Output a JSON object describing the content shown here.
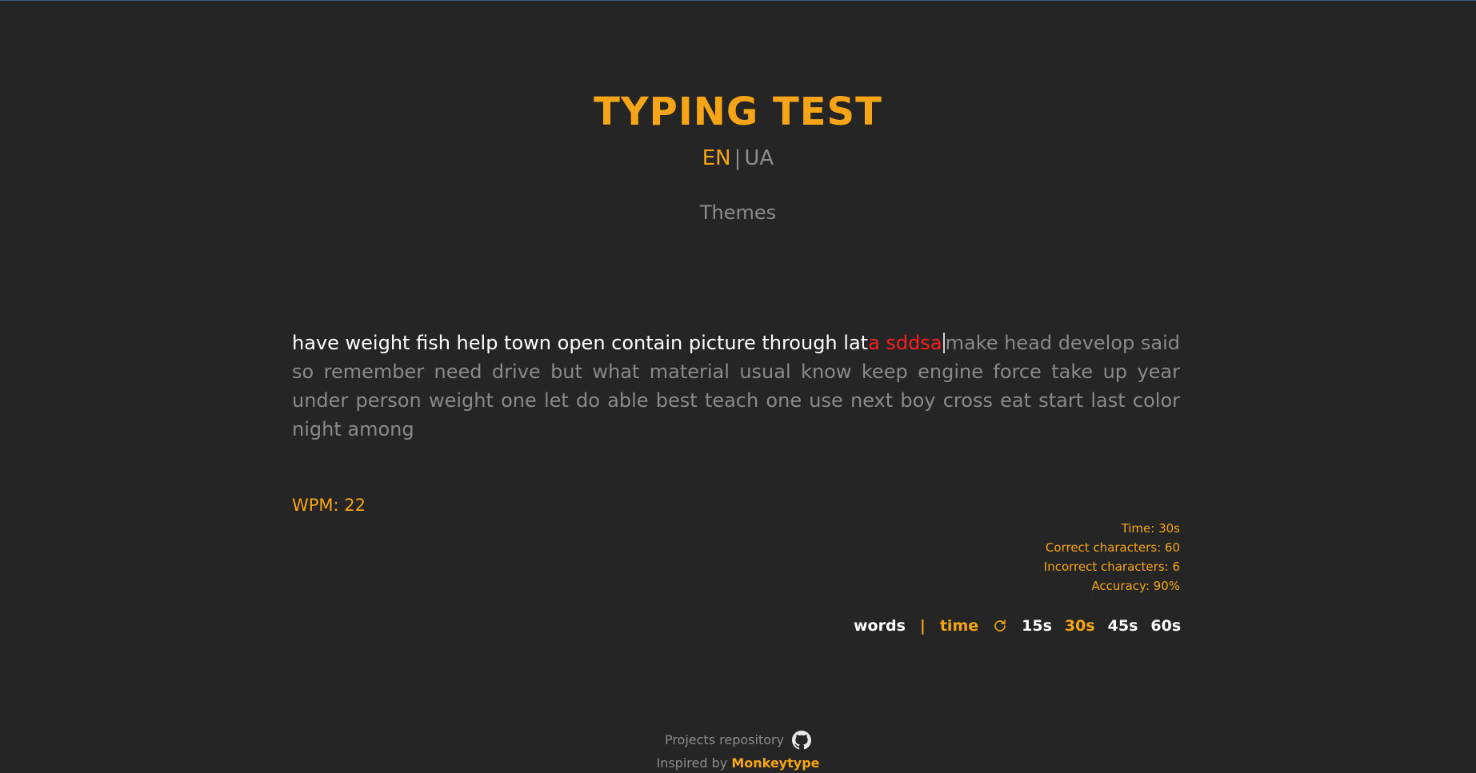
{
  "header": {
    "title": "TYPING TEST",
    "languages": {
      "active": "EN",
      "separator": "|",
      "other": "UA"
    },
    "themes_label": "Themes"
  },
  "test": {
    "typed_correct": "have weight fish help town open contain picture through lat",
    "typed_incorrect": "a sddsa",
    "remaining_first_line": "make head develop said so",
    "remaining_rest": "remember need drive but what material usual know keep engine force take up year under person weight one let do able best teach one use next boy cross eat start last color night among"
  },
  "results": {
    "wpm": "WPM: 22",
    "time": "Time: 30s",
    "correct_chars": "Correct characters: 60",
    "incorrect_chars": "Incorrect characters: 6",
    "accuracy": "Accuracy: 90%"
  },
  "modes": {
    "words_label": "words",
    "separator": "|",
    "time_label": "time",
    "active_mode": "time",
    "reload_icon": "reload-icon",
    "durations": [
      "15s",
      "30s",
      "45s",
      "60s"
    ],
    "active_duration": "30s"
  },
  "footer": {
    "repo_label": "Projects repository",
    "repo_icon": "github-icon",
    "credit_prefix": "Inspired by",
    "credit_link": "Monkeytype"
  },
  "colors": {
    "accent": "#f7a516",
    "background": "#252525",
    "error": "#ff1e1e",
    "muted": "#8a8a8a",
    "typed": "#ffffff"
  }
}
